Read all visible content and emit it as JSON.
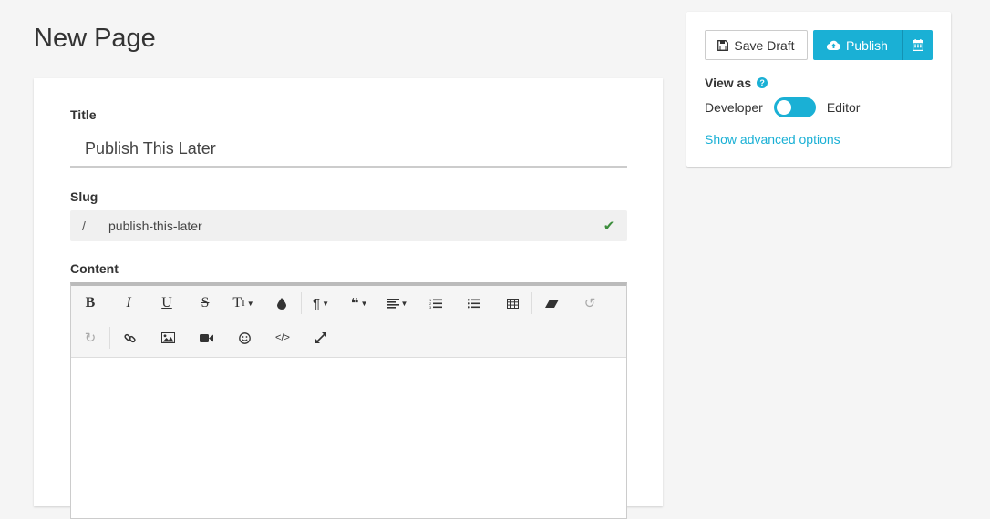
{
  "page": {
    "title": "New Page"
  },
  "form": {
    "title_label": "Title",
    "title_value": "Publish This Later",
    "slug_label": "Slug",
    "slug_prefix": "/",
    "slug_value": "publish-this-later",
    "content_label": "Content"
  },
  "toolbar": {
    "bold": "B",
    "italic": "I",
    "underline": "U",
    "strike": "S",
    "text_size": "T",
    "paragraph": "¶",
    "quote": "❝",
    "undo": "↺",
    "redo": "↻",
    "code": "</>"
  },
  "sidebar": {
    "save_draft": "Save Draft",
    "publish": "Publish",
    "view_as": "View as",
    "help": "?",
    "developer": "Developer",
    "editor": "Editor",
    "advanced": "Show advanced options"
  },
  "colors": {
    "accent": "#1ab0d5",
    "check": "#3c8d3c"
  }
}
